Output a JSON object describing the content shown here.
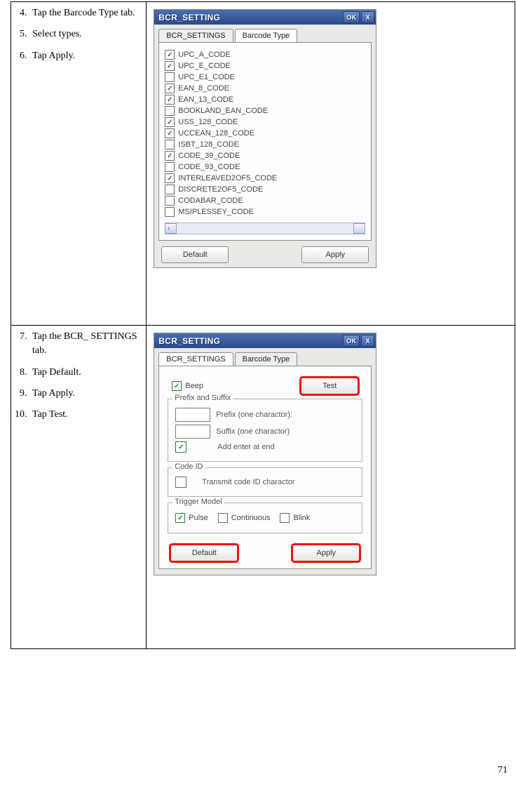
{
  "page_number": "71",
  "row1": {
    "steps": {
      "s4": "Tap the Barcode Type tab.",
      "s5": "Select types.",
      "s6": "Tap Apply."
    },
    "window_title": "BCR_SETTING",
    "ok": "OK",
    "close": "X",
    "tab1": "BCR_SETTINGS",
    "tab2": "Barcode Type",
    "items": [
      {
        "c": true,
        "t": "UPC_A_CODE"
      },
      {
        "c": true,
        "t": "UPC_E_CODE"
      },
      {
        "c": false,
        "t": "UPC_E1_CODE"
      },
      {
        "c": true,
        "t": "EAN_8_CODE"
      },
      {
        "c": true,
        "t": "EAN_13_CODE"
      },
      {
        "c": false,
        "t": "BOOKLAND_EAN_CODE"
      },
      {
        "c": true,
        "t": "USS_128_CODE"
      },
      {
        "c": true,
        "t": "UCCEAN_128_CODE"
      },
      {
        "c": false,
        "t": "ISBT_128_CODE"
      },
      {
        "c": true,
        "t": "CODE_39_CODE"
      },
      {
        "c": false,
        "t": "CODE_93_CODE"
      },
      {
        "c": true,
        "t": "INTERLEAVED2OF5_CODE"
      },
      {
        "c": false,
        "t": "DISCRETE2OF5_CODE"
      },
      {
        "c": false,
        "t": "CODABAR_CODE"
      },
      {
        "c": false,
        "t": "MSIPLESSEY_CODE"
      }
    ],
    "btn_default": "Default",
    "btn_apply": "Apply"
  },
  "row2": {
    "steps": {
      "s7": "Tap the BCR_ SETTINGS tab.",
      "s8": "Tap Default.",
      "s9": "Tap Apply.",
      "s10": "Tap Test."
    },
    "window_title": "BCR_SETTING",
    "ok": "OK",
    "close": "X",
    "tab1": "BCR_SETTINGS",
    "tab2": "Barcode Type",
    "beep": "Beep",
    "test": "Test",
    "grp_prefix": "Prefix and Suffix",
    "prefix_lbl": "Prefix (one charactor):",
    "suffix_lbl": "Suffix (one charactor)",
    "addenter": "Add enter at end",
    "grp_code": "Code ID",
    "transmit": "Transmit code ID charactor",
    "grp_trigger": "Trigger Model",
    "pulse": "Pulse",
    "continuous": "Continuous",
    "blink": "Blink",
    "btn_default": "Default",
    "btn_apply": "Apply"
  }
}
